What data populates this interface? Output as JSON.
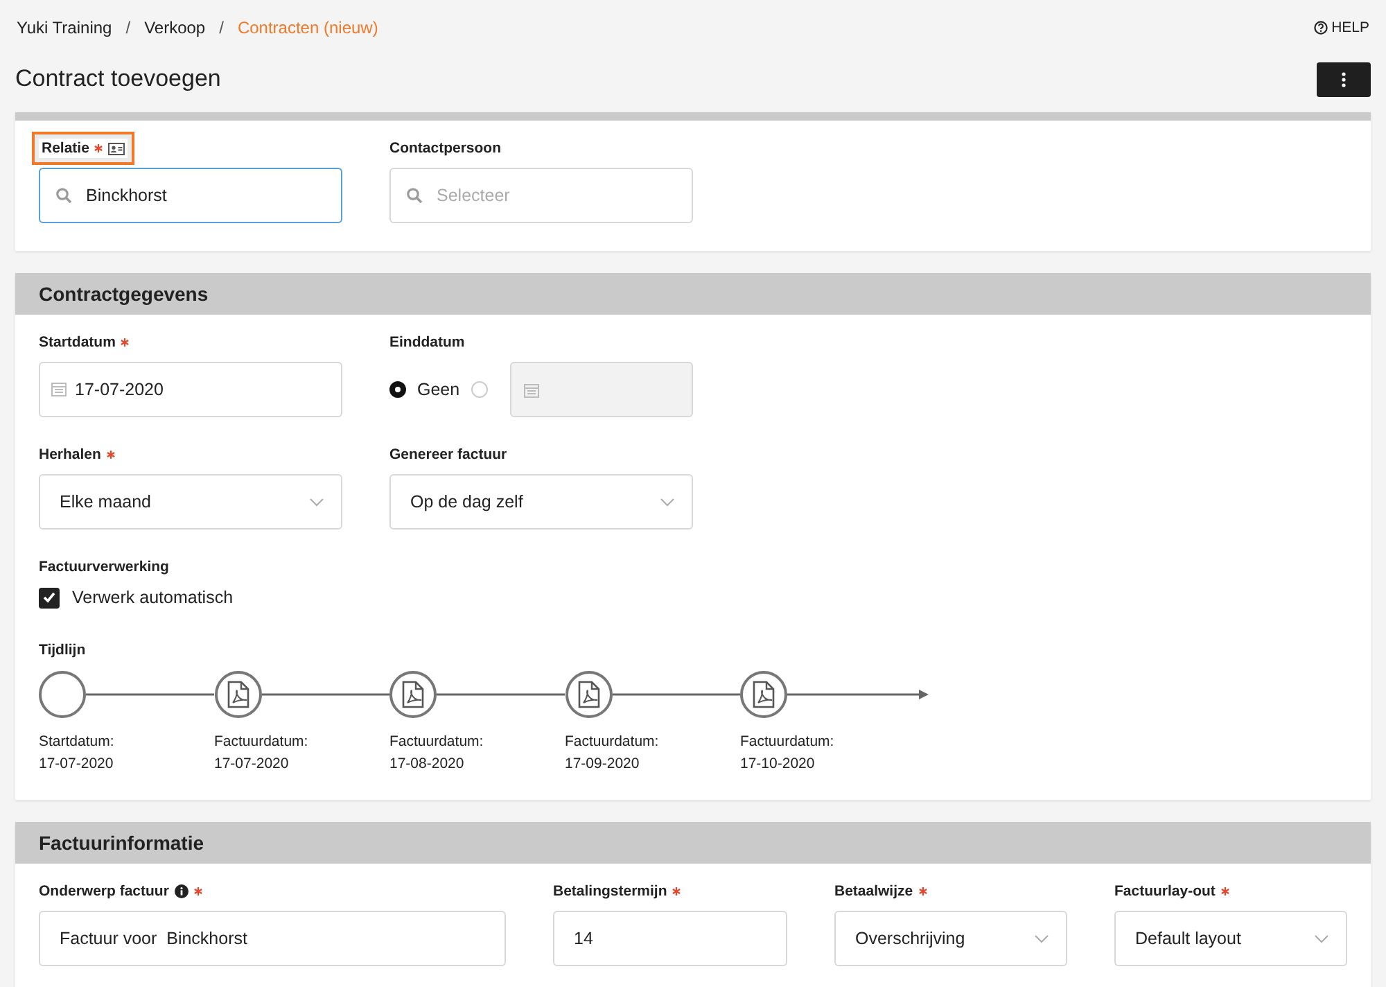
{
  "breadcrumb": {
    "items": [
      {
        "label": "Yuki Training",
        "selected": false
      },
      {
        "label": "Verkoop",
        "selected": false
      },
      {
        "label": "Contracten (nieuw)",
        "selected": true
      }
    ],
    "separators": [
      "/",
      "/"
    ]
  },
  "help": {
    "label": "HELP"
  },
  "title": "Contract toevoegen",
  "relation_card": {
    "fields": [
      {
        "kind": "search",
        "label": "Relatie",
        "required": true,
        "highlighted": true,
        "contact_card_icon": true,
        "value": "Binckhorst",
        "focused": true
      },
      {
        "kind": "search",
        "label": "Contactpersoon",
        "required": false,
        "highlighted": false,
        "placeholder": "Selecteer",
        "focused": false
      }
    ]
  },
  "contract_section": {
    "title": "Contractgegevens",
    "fields": [
      {
        "kind": "date",
        "label": "Startdatum",
        "required": true,
        "value": "17-07-2020"
      },
      {
        "kind": "end-date",
        "label": "Einddatum",
        "required": false,
        "none_option": {
          "label": "Geen",
          "selected": true
        },
        "date_option": {
          "selected": false
        }
      },
      {
        "kind": "select",
        "label": "Herhalen",
        "required": true,
        "value": "Elke maand"
      },
      {
        "kind": "select",
        "label": "Genereer factuur",
        "required": false,
        "value": "Op de dag zelf"
      },
      {
        "kind": "checkbox",
        "label": "Factuurverwerking",
        "required": false,
        "option": "Verwerk automatisch",
        "checked": true
      }
    ],
    "timeline": {
      "label": "Tijdlijn",
      "events": [
        {
          "kind": "start",
          "label": "Startdatum:",
          "date": "17-07-2020"
        },
        {
          "kind": "invoice",
          "label": "Factuurdatum:",
          "date": "17-07-2020"
        },
        {
          "kind": "invoice",
          "label": "Factuurdatum:",
          "date": "17-08-2020"
        },
        {
          "kind": "invoice",
          "label": "Factuurdatum:",
          "date": "17-09-2020"
        },
        {
          "kind": "invoice",
          "label": "Factuurdatum:",
          "date": "17-10-2020"
        }
      ]
    }
  },
  "invoice_section": {
    "title": "Factuurinformatie",
    "fields": [
      {
        "kind": "text",
        "label": "Onderwerp factuur",
        "required": true,
        "info_icon": true,
        "value": "Factuur voor  Binckhorst"
      },
      {
        "kind": "text",
        "label": "Betalingstermijn",
        "required": true,
        "value": "14"
      },
      {
        "kind": "select",
        "label": "Betaalwijze",
        "required": true,
        "value": "Overschrijving"
      },
      {
        "kind": "select",
        "label": "Factuurlay-out",
        "required": true,
        "value": "Default layout"
      }
    ]
  }
}
